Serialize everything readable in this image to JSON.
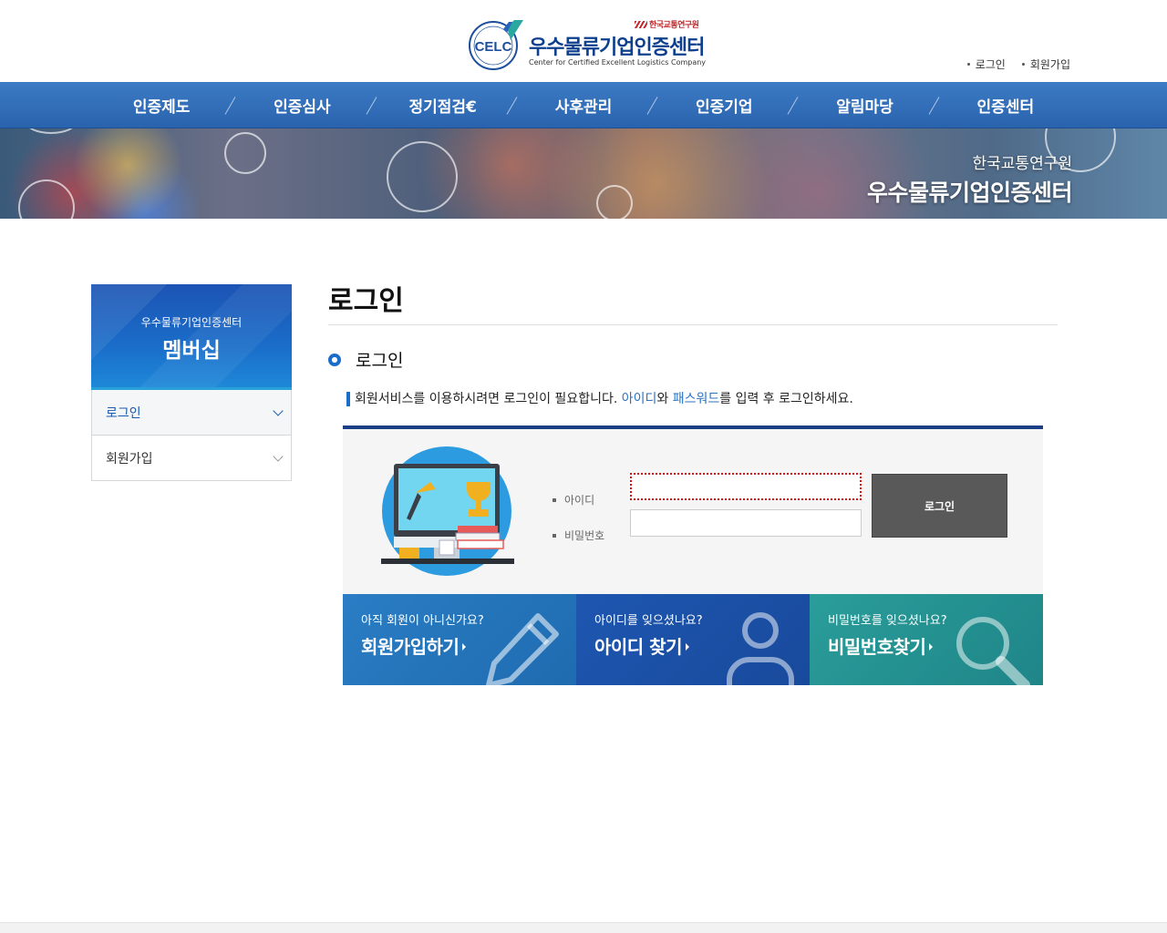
{
  "header": {
    "logo_emblem_text": "CELC",
    "logo_ring_text": "인증우수물류기업",
    "logo_ktr": "한국교통연구원",
    "logo_title": "우수물류기업인증센터",
    "logo_subtitle": "Center for Certified Excellent Logistics Company",
    "util": {
      "login": "로그인",
      "signup": "회원가입"
    }
  },
  "gnb": {
    "items": [
      "인증제도",
      "인증심사",
      "정기점검€",
      "사후관리",
      "인증기업",
      "알림마당",
      "인증센터"
    ]
  },
  "visual": {
    "line1": "한국교통연구원",
    "line2": "우수물류기업인증센터"
  },
  "lnb": {
    "subtitle": "우수물류기업인증센터",
    "title": "멤버십",
    "items": [
      {
        "label": "로그인"
      },
      {
        "label": "회원가입"
      }
    ]
  },
  "content": {
    "page_title": "로그인",
    "section_title": "로그인",
    "notice": {
      "before": "회원서비스를 이용하시려면 로그인이 필요합니다. ",
      "id_word": "아이디",
      "mid": "와 ",
      "pw_word": "패스워드",
      "after": "를 입력 후 로그인하세요."
    },
    "form": {
      "id_label": "아이디",
      "pw_label": "비밀번호",
      "id_value": "",
      "pw_value": "",
      "login_button": "로그인"
    },
    "quick": [
      {
        "sub": "아직 회원이 아니신가요?",
        "main": "회원가입하기",
        "icon": "pencil-icon"
      },
      {
        "sub": "아이디를 잊으셨나요?",
        "main": "아이디 찾기",
        "icon": "person-icon"
      },
      {
        "sub": "비밀번호를 잊으셨나요?",
        "main": "비밀번호찾기",
        "icon": "magnifier-icon"
      }
    ]
  },
  "colors": {
    "gnb_blue": "#2f6db8",
    "accent_blue": "#1a6dc9",
    "login_button": "#595959",
    "quick_1": "#2a7dc4",
    "quick_2": "#1e56b0",
    "quick_3": "#2a9d9a"
  }
}
